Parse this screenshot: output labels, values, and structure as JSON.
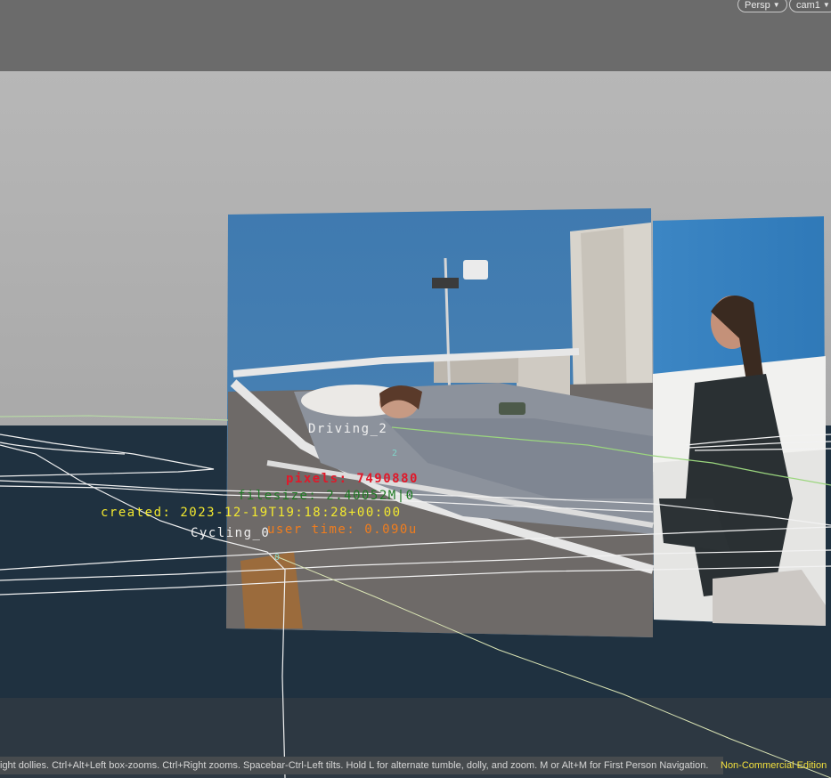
{
  "viewport": {
    "projection_menu": "Persp",
    "camera_menu": "cam1",
    "colors": {
      "sky": "#b0b0b0",
      "ground": "#1f3140",
      "header": "#6b6b6b"
    }
  },
  "scene": {
    "card_main": "photo-hospital-bed",
    "card_side": "photo-woman-sitting-hospital",
    "labels": {
      "driving": "Driving_2",
      "driving_index": "2",
      "cycling": "Cycling_0",
      "cycling_index": "0"
    },
    "info": {
      "pixels": "pixels: 7490880",
      "filesize": "filesize: 2.40052M|0",
      "created": "created: 2023-12-19T19:18:28+00:00",
      "user_time": "user time: 0.090u"
    }
  },
  "status": {
    "hint": "ight dollies. Ctrl+Alt+Left box-zooms. Ctrl+Right zooms. Spacebar-Ctrl-Left tilts. Hold L for alternate tumble, dolly, and zoom.      M or Alt+M for First Person Navigation.",
    "edition": "Non-Commercial Edition"
  }
}
